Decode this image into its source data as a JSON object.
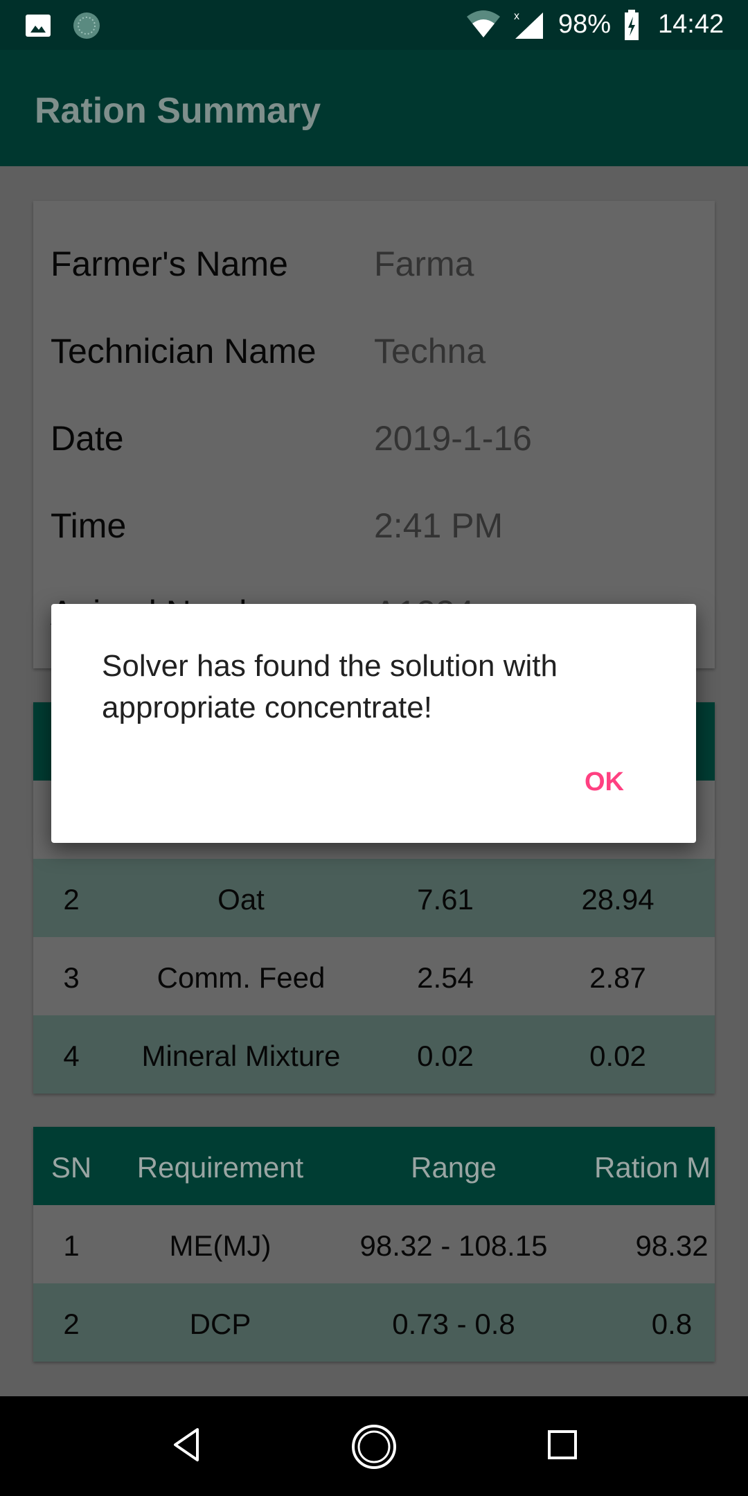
{
  "status_bar": {
    "battery": "98%",
    "time": "14:42",
    "icons": [
      "image-icon",
      "loading-icon",
      "wifi-icon",
      "signal-icon",
      "battery-charging-icon"
    ]
  },
  "app_bar": {
    "title": "Ration Summary"
  },
  "info": [
    {
      "label": "Farmer's Name",
      "value": "Farma"
    },
    {
      "label": "Technician Name",
      "value": "Techna"
    },
    {
      "label": "Date",
      "value": "2019-1-16"
    },
    {
      "label": "Time",
      "value": "2:41 PM"
    },
    {
      "label": "Animal Number",
      "value": "A1234"
    }
  ],
  "feed_table": {
    "rows": [
      {
        "sn": "2",
        "name": "Oat",
        "c3": "7.61",
        "c4": "28.94"
      },
      {
        "sn": "3",
        "name": "Comm. Feed",
        "c3": "2.54",
        "c4": "2.87"
      },
      {
        "sn": "4",
        "name": "Mineral Mixture",
        "c3": "0.02",
        "c4": "0.02"
      }
    ]
  },
  "requirement_table": {
    "headers": {
      "sn": "SN",
      "requirement": "Requirement",
      "range": "Range",
      "ration": "Ration M"
    },
    "rows": [
      {
        "sn": "1",
        "requirement": "ME(MJ)",
        "range": "98.32 - 108.15",
        "ration": "98.32"
      },
      {
        "sn": "2",
        "requirement": "DCP",
        "range": "0.73 - 0.8",
        "ration": "0.8"
      }
    ]
  },
  "dialog": {
    "message": "Solver has found the solution with appropriate concentrate!",
    "ok_label": "OK",
    "ok_color": "#ff4081"
  },
  "colors": {
    "primary": "#00897b",
    "status_bar": "#00302a",
    "row_alt": "#b9ebde"
  }
}
